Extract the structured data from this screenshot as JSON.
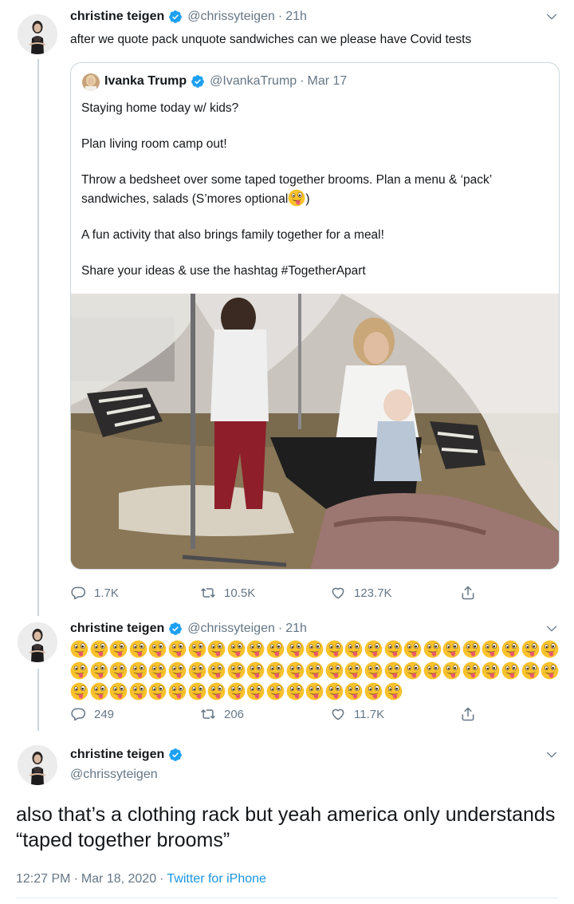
{
  "colors": {
    "accent": "#1da1f2",
    "secondary_text": "#657786",
    "border": "#ccd6dd",
    "emoji_face": "#f9c22c"
  },
  "tweet1": {
    "name": "christine teigen",
    "handle": "@chrissyteigen",
    "time": "21h",
    "text": "after we quote pack unquote sandwiches can we please have Covid tests"
  },
  "quote": {
    "name": "Ivanka Trump",
    "handle": "@IvankaTrump",
    "time": "Mar 17",
    "p1": "Staying home today w/ kids?",
    "p2": "Plan living room camp out!",
    "p3a": "Throw a bedsheet over some taped together brooms. Plan a menu & ‘pack’ sandwiches, salads (S’mores optional",
    "p3b": ")",
    "p4": "A fun activity that also brings family together for a meal!",
    "p5": "Share your ideas & use the hashtag #TogetherApart",
    "emoji": "zany-face"
  },
  "tweet1_actions": {
    "replies": "1.7K",
    "retweets": "10.5K",
    "likes": "123.7K"
  },
  "tweet2": {
    "name": "christine teigen",
    "handle": "@chrissyteigen",
    "time": "21h",
    "emoji_name": "zany-face",
    "emoji_count": 67
  },
  "tweet2_actions": {
    "replies": "249",
    "retweets": "206",
    "likes": "11.7K"
  },
  "tweet3": {
    "name": "christine teigen",
    "handle": "@chrissyteigen",
    "text": "also that’s a clothing rack but yeah america only understands “taped together brooms”",
    "time": "12:27 PM",
    "date": "Mar 18, 2020",
    "source": "Twitter for iPhone"
  },
  "separator": "·"
}
